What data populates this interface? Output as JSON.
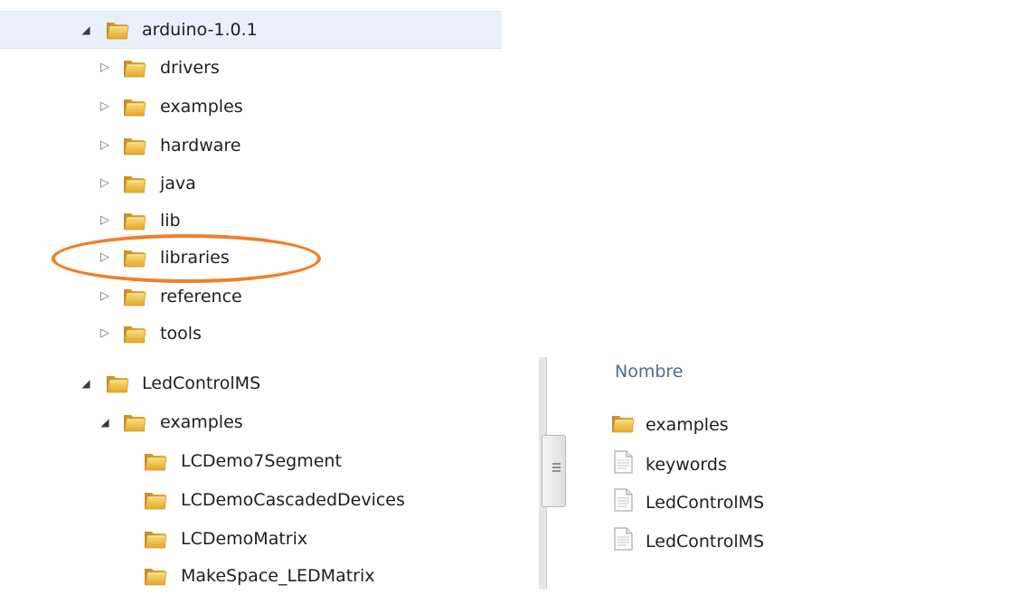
{
  "top_tree": {
    "root": {
      "label": "arduino-1.0.1",
      "expanded": true
    },
    "children": [
      {
        "label": "drivers"
      },
      {
        "label": "examples"
      },
      {
        "label": "hardware"
      },
      {
        "label": "java"
      },
      {
        "label": "lib"
      },
      {
        "label": "libraries",
        "highlighted": true
      },
      {
        "label": "reference"
      },
      {
        "label": "tools"
      }
    ]
  },
  "bottom_tree": {
    "root": {
      "label": "LedControlMS",
      "expanded": true
    },
    "sub": {
      "label": "examples",
      "expanded": true
    },
    "items": [
      {
        "label": "LCDemo7Segment"
      },
      {
        "label": "LCDemoCascadedDevices"
      },
      {
        "label": "LCDemoMatrix"
      },
      {
        "label": "MakeSpace_LEDMatrix"
      }
    ]
  },
  "file_list": {
    "column_header": "Nombre",
    "files": [
      {
        "name": "examples",
        "icon": "folder-icon"
      },
      {
        "name": "keywords",
        "icon": "text-file-icon"
      },
      {
        "name": "LedControlMS",
        "icon": "text-file-icon"
      },
      {
        "name": "LedControlMS",
        "icon": "text-file-icon"
      }
    ]
  },
  "colors": {
    "selection": "#e8f1fb",
    "highlight": "#f07f2a",
    "folder": "#f1c04a",
    "header_text": "#4f6b90"
  }
}
